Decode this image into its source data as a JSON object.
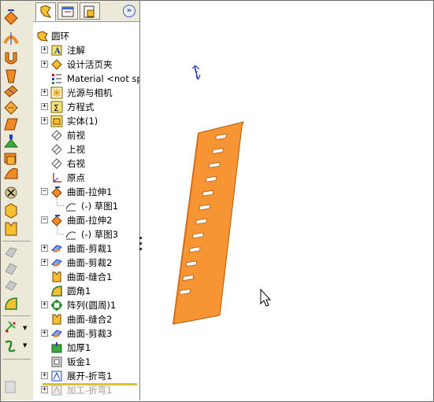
{
  "toolbar": {
    "icons": [
      "extrude-surface-icon",
      "revolve-surface-icon",
      "sweep-surface-icon",
      "loft-surface-icon",
      "boundary-surface-icon",
      "offset-surface-icon",
      "planar-surface-icon",
      "thicken-icon",
      "surface-fill-icon",
      "ruled-surface-icon",
      "delete-face-icon",
      "move-face-icon",
      "knit-surface-icon",
      "trim-surface-icon",
      "untrim-surface-icon",
      "extend-surface-icon",
      "fillet-icon",
      "curve-icon",
      "helix-icon"
    ]
  },
  "tree": {
    "root": "圆环",
    "items": [
      {
        "label": "注解",
        "expander": "+"
      },
      {
        "label": "设计活页夹",
        "expander": "+"
      },
      {
        "label": "Material <not specified>",
        "expander": ""
      },
      {
        "label": "光源与相机",
        "expander": "+"
      },
      {
        "label": "方程式",
        "expander": "+"
      },
      {
        "label": "实体(1)",
        "expander": "+"
      },
      {
        "label": "前视",
        "expander": ""
      },
      {
        "label": "上视",
        "expander": ""
      },
      {
        "label": "右视",
        "expander": ""
      },
      {
        "label": "原点",
        "expander": ""
      },
      {
        "label": "曲面-拉伸1",
        "expander": "−"
      },
      {
        "label": "(-) 草图1",
        "expander": ""
      },
      {
        "label": "曲面-拉伸2",
        "expander": "−"
      },
      {
        "label": "(-) 草图3",
        "expander": ""
      },
      {
        "label": "曲面-剪裁1",
        "expander": "+"
      },
      {
        "label": "曲面-剪裁2",
        "expander": "+"
      },
      {
        "label": "曲面-缝合1",
        "expander": ""
      },
      {
        "label": "圆角1",
        "expander": ""
      },
      {
        "label": "阵列(圆周)1",
        "expander": "+"
      },
      {
        "label": "曲面-缝合2",
        "expander": ""
      },
      {
        "label": "曲面-剪裁3",
        "expander": "+"
      },
      {
        "label": "加厚1",
        "expander": ""
      },
      {
        "label": "钣金1",
        "expander": ""
      },
      {
        "label": "展开-折弯1",
        "expander": "+"
      },
      {
        "label": "加工-折弯1",
        "expander": "+"
      }
    ]
  },
  "colors": {
    "part_fill": "#f79535",
    "part_edge": "#b45a0a",
    "slot_fill": "#ffffff",
    "triad": "#1f3fbf"
  }
}
